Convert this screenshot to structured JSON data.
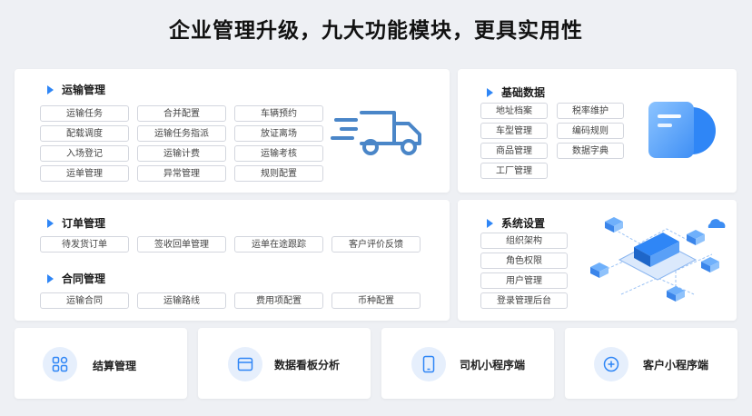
{
  "page": {
    "title": "企业管理升级，九大功能模块，更具实用性"
  },
  "transport": {
    "title": "运输管理",
    "items": [
      "运输任务",
      "合并配置",
      "车辆预约",
      "配载调度",
      "运输任务指派",
      "放证离场",
      "入场登记",
      "运输计费",
      "运输考核",
      "运单管理",
      "异常管理",
      "规则配置"
    ]
  },
  "basic": {
    "title": "基础数据",
    "items": [
      "地址档案",
      "税率维护",
      "车型管理",
      "编码规则",
      "商品管理",
      "数据字典",
      "工厂管理"
    ]
  },
  "order": {
    "title": "订单管理",
    "items": [
      "待发货订单",
      "签收回单管理",
      "运单在途跟踪",
      "客户评价反馈"
    ]
  },
  "contract": {
    "title": "合同管理",
    "items": [
      "运输合同",
      "运输路线",
      "费用项配置",
      "币种配置"
    ]
  },
  "system": {
    "title": "系统设置",
    "items": [
      "组织架构",
      "角色权限",
      "用户管理",
      "登录管理后台"
    ]
  },
  "bottom": [
    {
      "label": "结算管理",
      "icon": "grid-icon"
    },
    {
      "label": "数据看板分析",
      "icon": "monitor-icon"
    },
    {
      "label": "司机小程序端",
      "icon": "phone-icon"
    },
    {
      "label": "客户小程序端",
      "icon": "plus-circle-icon"
    }
  ],
  "colors": {
    "accent": "#2f86f6",
    "icon_bg": "#e6effc"
  }
}
